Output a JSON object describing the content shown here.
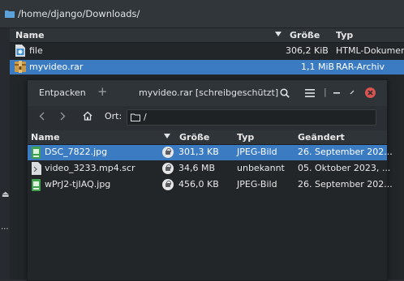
{
  "pathbar": {
    "path": "/home/django/Downloads/"
  },
  "outer": {
    "columns": {
      "name": "Name",
      "size": "Größe",
      "type": "Typ"
    },
    "rows": [
      {
        "name": "file",
        "size": "306,2 KiB",
        "type": "HTML-Dokument"
      },
      {
        "name": "myvideo.rar",
        "size": "1,1 MiB",
        "type": "RAR-Archiv"
      }
    ]
  },
  "dialog": {
    "extract_label": "Entpacken",
    "add_label": "+",
    "title": "myvideo.rar [schreibgeschützt]",
    "location_label": "Ort:",
    "location_value": "/",
    "columns": {
      "name": "Name",
      "size": "Größe",
      "type": "Typ",
      "modified": "Geändert"
    },
    "rows": [
      {
        "name": "DSC_7822.jpg",
        "size": "301,3 KB",
        "type": "JPEG-Bild",
        "modified": "26. September 202..."
      },
      {
        "name": "video_3233.mp4.scr",
        "size": "34,6 MB",
        "type": "unbekannt",
        "modified": "05. Oktober 2023, ..."
      },
      {
        "name": "wPrJ2-tjIAQ.jpg",
        "size": "456,0 KB",
        "type": "JPEG-Bild",
        "modified": "26. September 202..."
      }
    ]
  },
  "colors": {
    "selection": "#3b7bc2",
    "close": "#d9534f"
  },
  "sidebar": {
    "dots": "..."
  }
}
